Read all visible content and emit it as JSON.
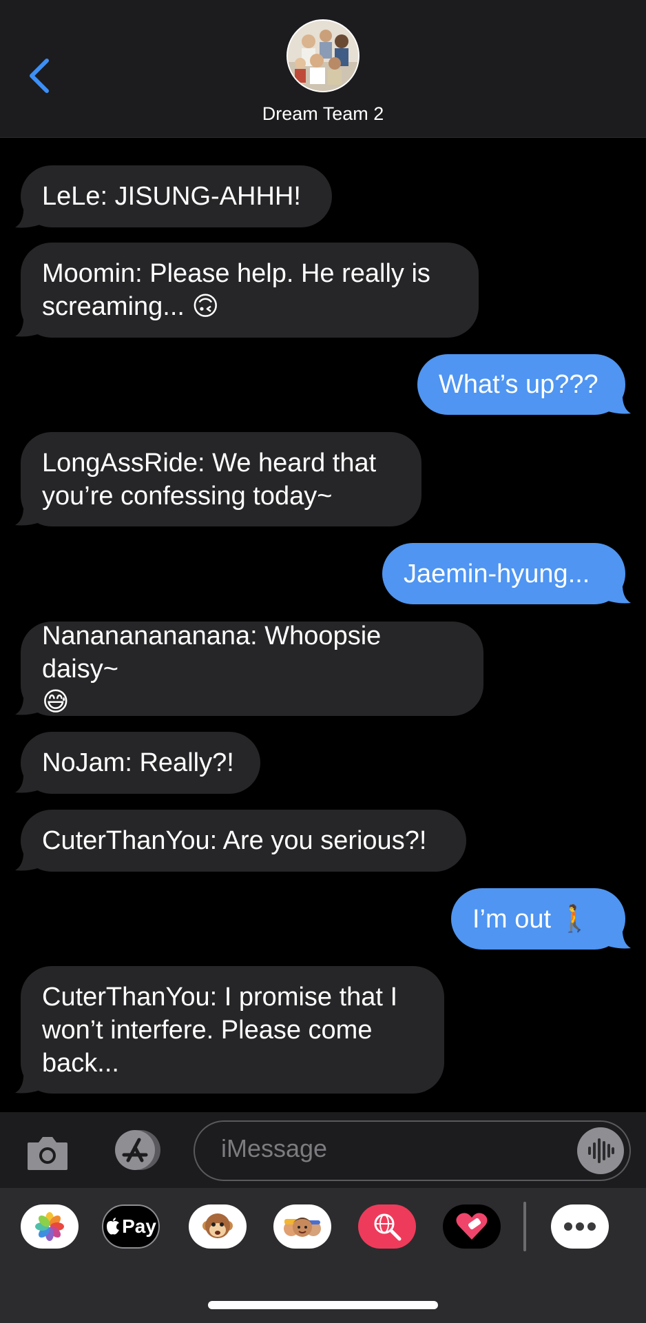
{
  "header": {
    "back_icon": "chevron-left-icon",
    "group_name": "Dream Team 2"
  },
  "messages": [
    {
      "direction": "received",
      "text": "LeLe: JISUNG-AHHH!"
    },
    {
      "direction": "received",
      "text": "Moomin: Please help. He really is\nscreaming... 🙃"
    },
    {
      "direction": "sent",
      "text": "What’s up???"
    },
    {
      "direction": "received",
      "text": "LongAssRide: We heard that\nyou’re confessing today~"
    },
    {
      "direction": "sent",
      "text": "Jaemin-hyung..."
    },
    {
      "direction": "received",
      "text": "Nanananananana: Whoopsie daisy~\n😅"
    },
    {
      "direction": "received",
      "text": "NoJam: Really?!"
    },
    {
      "direction": "received",
      "text": "CuterThanYou: Are you serious?!"
    },
    {
      "direction": "sent",
      "text": "I’m out 🚶"
    },
    {
      "direction": "received",
      "text": "CuterThanYou: I promise that I\nwon’t interfere. Please come\nback..."
    }
  ],
  "input": {
    "placeholder": "iMessage",
    "camera_icon": "camera-icon",
    "appstore_icon": "app-store-icon",
    "voice_icon": "waveform-icon"
  },
  "app_drawer": {
    "apps": [
      {
        "name": "photos-app-icon"
      },
      {
        "name": "apple-pay-app-icon",
        "label": "Pay"
      },
      {
        "name": "animoji-app-icon"
      },
      {
        "name": "memoji-stickers-app-icon"
      },
      {
        "name": "web-images-search-app-icon"
      },
      {
        "name": "digital-touch-app-icon"
      },
      {
        "name": "more-apps-icon"
      }
    ]
  },
  "colors": {
    "sent_bubble": "#4f95f1",
    "received_bubble": "#262628",
    "accent": "#3d8ff5"
  }
}
